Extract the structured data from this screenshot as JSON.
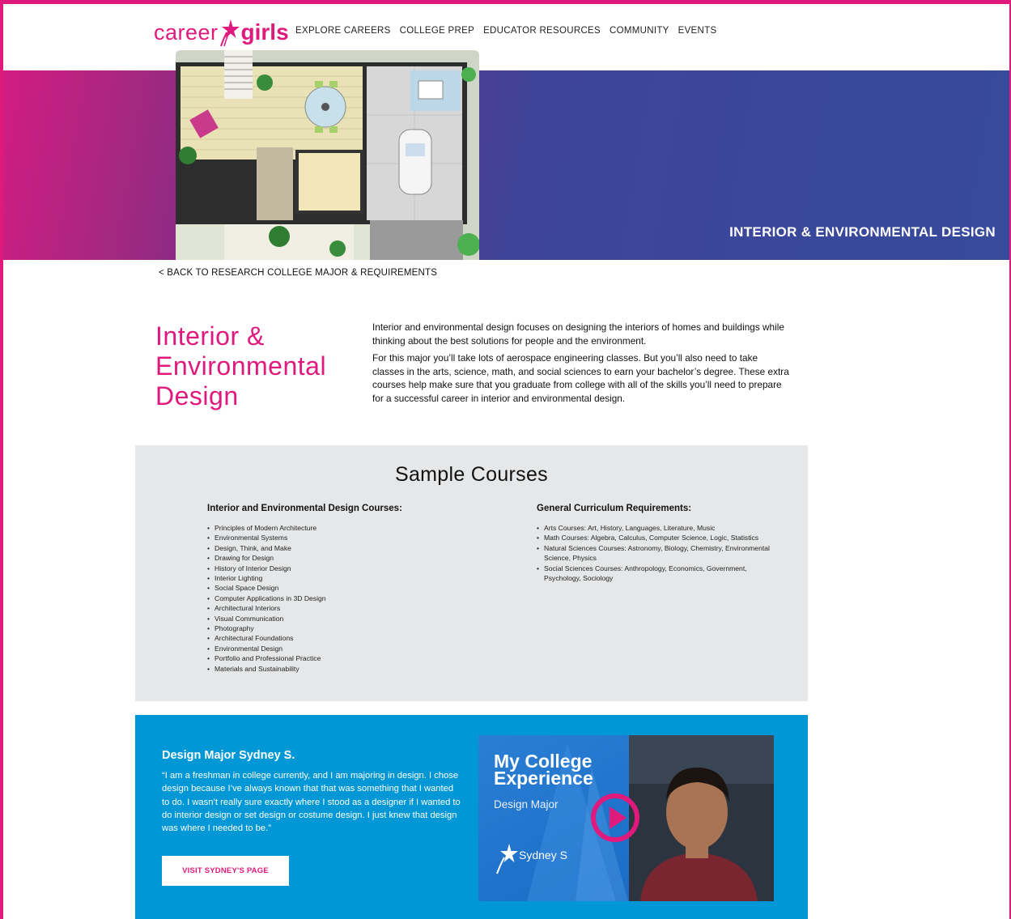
{
  "header": {
    "logo": {
      "part1": "career",
      "part2": "girls"
    },
    "nav": [
      "EXPLORE CAREERS",
      "COLLEGE PREP",
      "EDUCATOR RESOURCES",
      "COMMUNITY",
      "EVENTS"
    ]
  },
  "banner": {
    "title": "INTERIOR & ENVIRONMENTAL DESIGN",
    "image_icon": "floor-plan-illustration"
  },
  "back_link": "< BACK TO RESEARCH COLLEGE MAJOR & REQUIREMENTS",
  "major": {
    "title_lines": [
      "Interior &",
      "Environmental",
      "Design"
    ],
    "paragraphs": [
      "Interior and environmental design focuses on designing the interiors of homes and buildings while thinking about the best solutions for people and the environment.",
      "For this major you’ll take lots of aerospace engineering classes. But you’ll also need to take classes in the arts, science, math, and social sciences to earn your bachelor’s degree. These extra courses help make sure that you graduate from college with all of the skills you’ll need to prepare for a successful career in interior and environmental design."
    ]
  },
  "courses": {
    "heading": "Sample Courses",
    "left": {
      "title": "Interior and Environmental Design Courses:",
      "items": [
        "Principles of Modern Architecture",
        "Environmental Systems",
        "Design, Think, and Make",
        "Drawing for Design",
        "History of Interior Design",
        "Interior Lighting",
        "Social Space Design",
        "Computer Applications in 3D Design",
        "Architectural Interiors",
        "Visual Communication",
        "Photography",
        "Architectural Foundations",
        "Environmental Design",
        "Portfolio and Professional Practice",
        "Materials and Sustainability"
      ]
    },
    "right": {
      "title": "General Curriculum Requirements:",
      "items": [
        "Arts Courses: Art, History, Languages, Literature, Music",
        "Math Courses: Algebra, Calculus, Computer Science, Logic, Statistics",
        "Natural Sciences Courses: Astronomy, Biology, Chemistry, Environmental Science, Physics",
        "Social Sciences Courses: Anthropology, Economics, Government, Psychology, Sociology"
      ]
    }
  },
  "testimonial": {
    "name": "Design Major Sydney S.",
    "quote": "“I am a freshman in college currently, and I am majoring in design. I chose design because I’ve always known that that was something that I wanted to do. I wasn’t really sure exactly where I stood as a designer if I wanted to do interior design or set design or costume design. I just knew that design was where I needed to be.”",
    "button": "VISIT SYDNEY'S PAGE",
    "video": {
      "title_line1": "My College",
      "title_line2": "Experience",
      "subtitle": "Design Major",
      "person": "Sydney S",
      "play_icon": "play-icon"
    }
  },
  "colors": {
    "brand_pink": "#e0197d",
    "banner_blue": "#374a9c",
    "testimonial_blue": "#0097d6",
    "courses_bg": "#e6e7e8"
  }
}
